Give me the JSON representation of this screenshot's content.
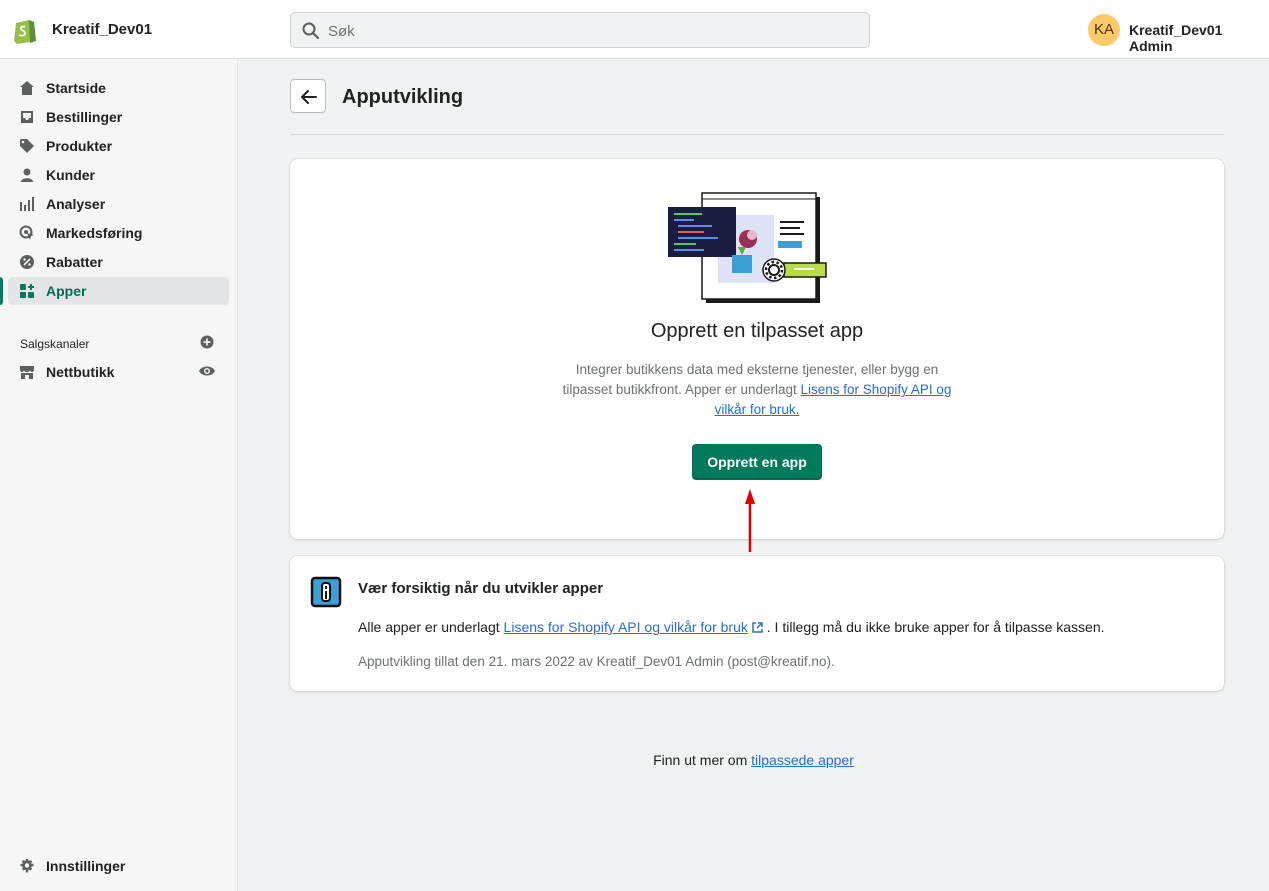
{
  "topbar": {
    "store_name": "Kreatif_Dev01",
    "search_placeholder": "Søk",
    "avatar_initials": "KA",
    "user_name": "Kreatif_Dev01 Admin"
  },
  "sidebar": {
    "items": [
      {
        "label": "Startside",
        "icon": "home-icon"
      },
      {
        "label": "Bestillinger",
        "icon": "orders-icon"
      },
      {
        "label": "Produkter",
        "icon": "tag-icon"
      },
      {
        "label": "Kunder",
        "icon": "person-icon"
      },
      {
        "label": "Analyser",
        "icon": "analytics-icon"
      },
      {
        "label": "Markedsføring",
        "icon": "marketing-icon"
      },
      {
        "label": "Rabatter",
        "icon": "discount-icon"
      },
      {
        "label": "Apper",
        "icon": "apps-icon",
        "active": true
      }
    ],
    "sales_channels_title": "Salgskanaler",
    "channels": [
      {
        "label": "Nettbutikk",
        "icon": "store-icon"
      }
    ],
    "settings_label": "Innstillinger"
  },
  "page": {
    "title": "Apputvikling"
  },
  "create_card": {
    "heading": "Opprett en tilpasset app",
    "desc_text": "Integrer butikkens data med eksterne tjenester, eller bygg en tilpasset butikkfront. Apper er underlagt ",
    "desc_link": "Lisens for Shopify API og vilkår for bruk.",
    "button_label": "Opprett en app"
  },
  "warning_card": {
    "title": "Vær forsiktig når du utvikler apper",
    "body_prefix": "Alle apper er underlagt ",
    "body_link": "Lisens for Shopify API og vilkår for bruk",
    "body_suffix": ". I tillegg må du ikke bruke apper for å tilpasse kassen.",
    "meta": "Apputvikling tillat den 21. mars 2022 av Kreatif_Dev01 Admin (post@kreatif.no)."
  },
  "footer": {
    "prefix": "Finn ut mer om ",
    "link": "tilpassede apper"
  },
  "colors": {
    "accent": "#008060",
    "button": "#007a5a",
    "link": "#2c6ecb",
    "annotation_arrow": "#e00000"
  }
}
